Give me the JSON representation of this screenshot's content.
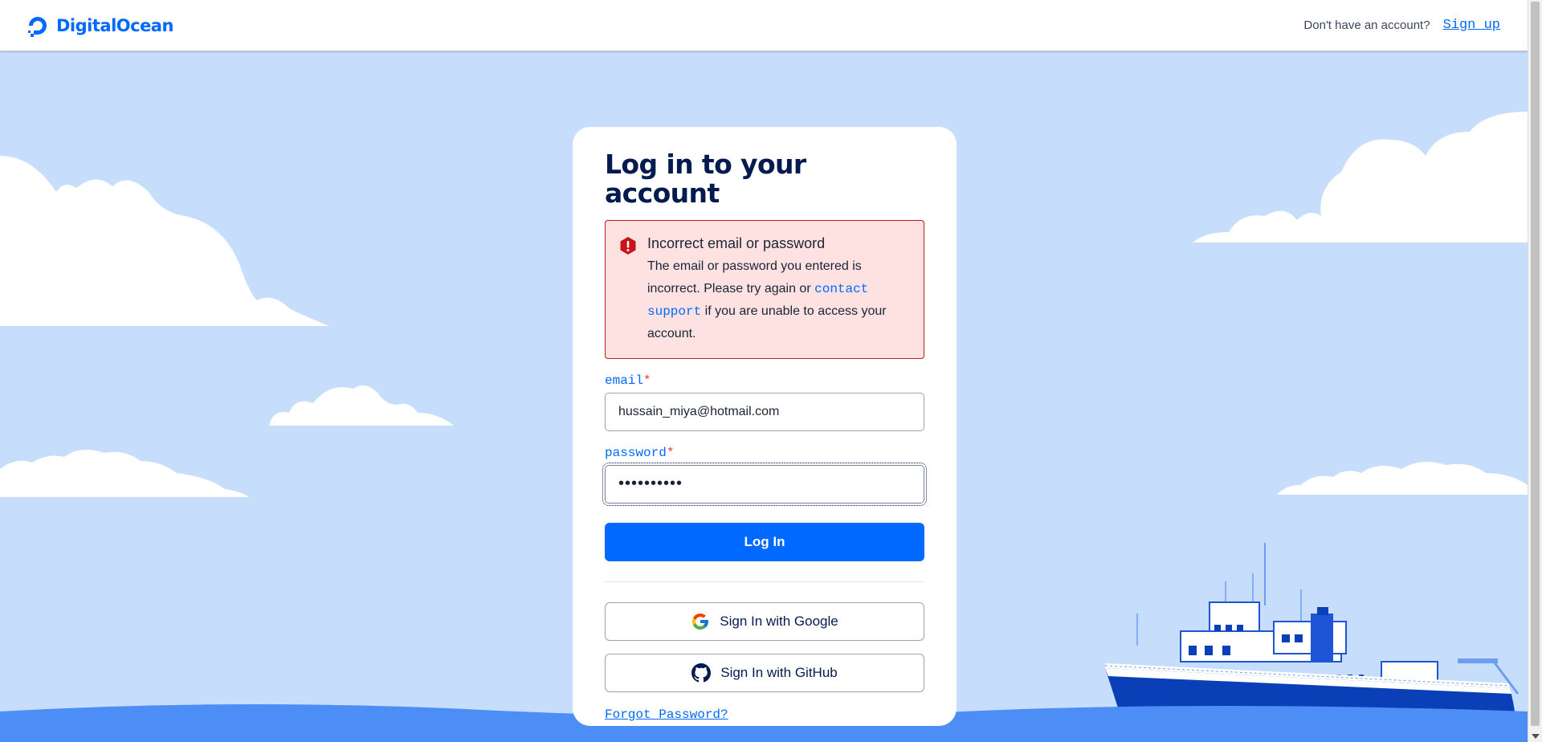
{
  "header": {
    "brand_name": "DigitalOcean",
    "no_account_text": "Don't have an account?",
    "signup_link": "Sign up"
  },
  "login": {
    "title": "Log in to your account",
    "alert": {
      "title": "Incorrect email or password",
      "text_before": "The email or password you entered is incorrect. Please try again or",
      "link": "contact support",
      "text_after": "if you are unable to access your account."
    },
    "email_label": "email",
    "email_value": "hussain_miya@hotmail.com",
    "password_label": "password",
    "password_value": "••••••••••",
    "required_marker": "*",
    "login_button": "Log In",
    "google_button": "Sign In with Google",
    "github_button": "Sign In with GitHub",
    "forgot_link": "Forgot Password?"
  },
  "colors": {
    "brand_blue": "#0069ff",
    "sky": "#c6ddfb",
    "sea": "#4c8df6",
    "alert_bg": "#fde2e1",
    "alert_border": "#b41f1f",
    "title_navy": "#031b4e"
  },
  "icons": [
    "digitalocean-logo-icon",
    "error-icon",
    "google-icon",
    "github-icon"
  ]
}
